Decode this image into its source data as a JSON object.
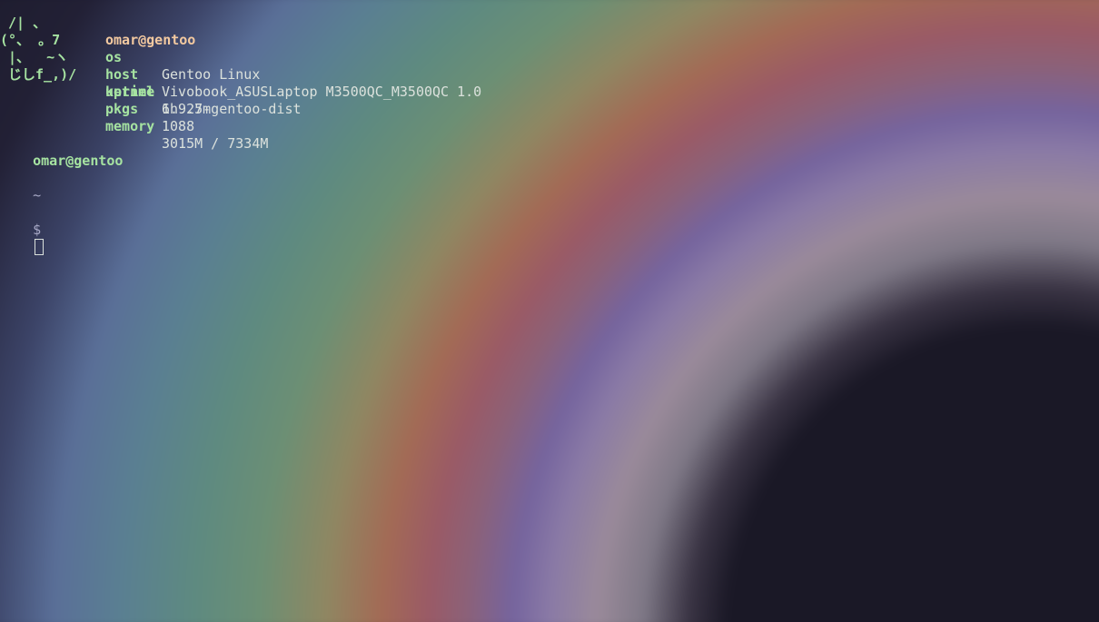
{
  "fetch": {
    "ascii_art": [
      " /| 、",
      "(°、 。7",
      " |、  ~ヽ",
      " じしf_,)/"
    ],
    "title": "omar@gentoo",
    "items": [
      {
        "key": "os",
        "value": "Gentoo Linux"
      },
      {
        "key": "host",
        "value": "Vivobook_ASUSLaptop M3500QC_M3500QC 1.0"
      },
      {
        "key": "kernel",
        "value": "6.9.7-gentoo-dist"
      },
      {
        "key": "uptime",
        "value": "1h 25m"
      },
      {
        "key": "pkgs",
        "value": "1088"
      },
      {
        "key": "memory",
        "value": "3015M / 7334M"
      }
    ]
  },
  "prompt": {
    "user_host": "omar@gentoo",
    "path": "~",
    "symbol": "$"
  },
  "colors": {
    "accent_green": "#a6e3a1",
    "title_peach": "#f3c9a0",
    "text": "#dbe1dc",
    "muted": "#a8a9c6",
    "background": "#1a1826"
  },
  "wallpaper": {
    "icon": "rainbow-halo-wallpaper"
  }
}
